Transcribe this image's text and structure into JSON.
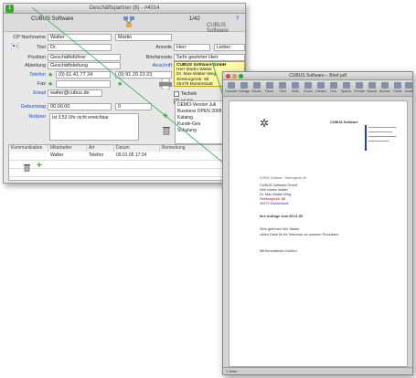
{
  "contact_window": {
    "title": "Geschäftspartner (6) - #4014",
    "badge": "1",
    "company_header": "CUBUS Software",
    "record_no": "1/42",
    "company_short": "CUBUS Software",
    "fields": {
      "lastname_label": "CP Nachname",
      "lastname_value": "Walter",
      "firstname_value": "Martin",
      "title_label": "Titel",
      "title_value": "Dr.",
      "salutation_label": "Anrede",
      "salutation_value": "Herr",
      "salutation2_value": "Lieber",
      "position_label": "Position",
      "position_value": "Geschäftsführer",
      "letter_salutation_label": "Briefanrede",
      "letter_salutation_value": "Sehr geehrter Herr",
      "department_label": "Abteilung",
      "department_value": "Geschäftsleitung",
      "address_label": "Anschrift",
      "phone_label": "Telefon",
      "phone_value": "(0) 61 41 77 24",
      "phone2_value": "(0) 91 20 23 23",
      "fax_label": "Fax",
      "email_label": "Email",
      "email_value": "walter@cubus.de",
      "birthday_label": "Geburtstag",
      "birthday_value": "00.00.00",
      "birthday_extra": "0",
      "notes_label": "Notizen",
      "notes_value": "Ist 3.53 Uhr nicht erreichbar"
    },
    "address_lines": [
      "CUBUS Software GmbH",
      "Herr Martin Walter",
      "Dr. Max-Walter-Weg",
      "Seeburgerstr. 86",
      "45479 Musterstadt"
    ],
    "checkbox_labels": [
      "Technik",
      "ist Kd."
    ],
    "list_items": [
      "DEMO-Version Juli",
      "Business OPEN 2005",
      "Katalog",
      "Kunde-Ges",
      "Schulung"
    ],
    "table": {
      "headers": [
        "Kommunikation",
        "Mitarbeiter",
        "Art",
        "Datum",
        "Bemerkung"
      ],
      "row": [
        "",
        "Walter",
        "Telefon",
        "09.01.05 17:24",
        ""
      ]
    }
  },
  "document_window": {
    "title": "CUBUS Software – Brief.pdf",
    "toolbar": [
      "Drucken",
      "Vorlage",
      "Rücks.",
      "Favor.",
      "Pfeil",
      "Seite",
      "Zoom",
      "Drehen",
      "Dok.",
      "Speich.",
      "Format",
      "Vorsch.",
      "Suchen",
      "Farbe",
      "Inhalt"
    ],
    "letter": {
      "company_short": "CUBUS Software",
      "sender_line": "CUBUS Software · Seeburgerstr. 86",
      "recipient": [
        "CUBUS Software GmbH",
        "Herr Martin Walter",
        "Dr. Max-Walter-Weg",
        "Seeburgerstr. 86",
        "45479 Musterstadt"
      ],
      "subject": "Ihre Anfrage vom 09.01.05",
      "body_lines": [
        "Sehr geehrter Herr Walter,",
        "vielen Dank für Ihr Interesse an unseren Produkten.",
        "Mit freundlichen Grüßen"
      ]
    },
    "status": "1 Seite"
  },
  "colors": {
    "accent_blue": "#1a4fd0",
    "arrow_green": "#22b14c",
    "address_yellow": "#fff9a8"
  }
}
